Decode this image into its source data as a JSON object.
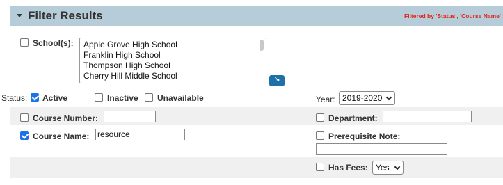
{
  "header": {
    "title": "Filter Results",
    "filtered_note": "Filtered by 'Status', 'Course Name'"
  },
  "schools": {
    "label": "School(s):",
    "checked": false,
    "options": [
      "Apple Grove High School",
      "Franklin High School",
      "Thompson High School",
      "Cherry Hill Middle School"
    ]
  },
  "status": {
    "label": "Status:",
    "items": [
      {
        "label": "Active",
        "checked": true
      },
      {
        "label": "Inactive",
        "checked": false
      },
      {
        "label": "Unavailable",
        "checked": false
      }
    ]
  },
  "year": {
    "label": "Year:",
    "value": "2019-2020"
  },
  "course_number": {
    "label": "Course Number:",
    "checked": false,
    "value": ""
  },
  "department": {
    "label": "Department:",
    "checked": false,
    "value": ""
  },
  "course_name": {
    "label": "Course Name:",
    "checked": true,
    "value": "resource"
  },
  "prerequisite_note": {
    "label": "Prerequisite Note:",
    "checked": false,
    "value": ""
  },
  "has_fees": {
    "label": "Has Fees:",
    "checked": false,
    "value": "Yes"
  },
  "colors": {
    "header_bg": "#b6cdd9",
    "filtered_note": "#e0261e",
    "checkbox_checked": "#1a73e8",
    "go_button": "#1f6fa8"
  }
}
